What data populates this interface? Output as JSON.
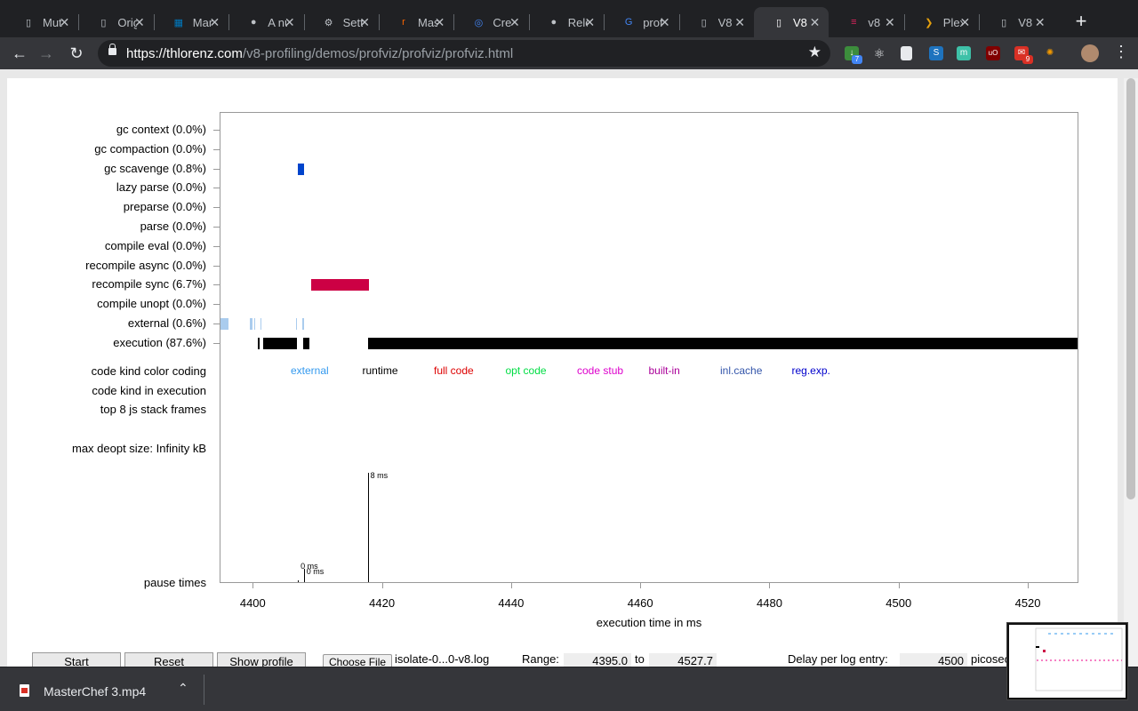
{
  "tabs": [
    {
      "title": "Mut",
      "icon": "page-icon"
    },
    {
      "title": "Orig",
      "icon": "page-icon"
    },
    {
      "title": "Mar",
      "icon": "trello-icon"
    },
    {
      "title": "A nu",
      "icon": "github-icon"
    },
    {
      "title": "Setti",
      "icon": "gear-icon"
    },
    {
      "title": "Mas",
      "icon": "rtve-icon"
    },
    {
      "title": "Cre",
      "icon": "chrome-icon"
    },
    {
      "title": "Rele",
      "icon": "github-icon"
    },
    {
      "title": "prof",
      "icon": "google-icon"
    },
    {
      "title": "V8",
      "icon": "page-icon"
    },
    {
      "title": "V8",
      "icon": "page-icon",
      "active": true
    },
    {
      "title": "v8",
      "icon": "ruler-icon"
    },
    {
      "title": "Plex",
      "icon": "plex-icon"
    },
    {
      "title": "V8",
      "icon": "page-icon"
    }
  ],
  "address": {
    "host": "https://thlorenz.com",
    "path": "/v8-profiling/demos/profviz/profviz/profviz.html"
  },
  "extensions": {
    "badge_1": "7",
    "badge_2": "9"
  },
  "chart_data": {
    "type": "timeline",
    "title": "",
    "xlabel": "execution time in ms",
    "ylabel": "",
    "xlim": [
      4395.0,
      4527.7
    ],
    "x_ticks": [
      "4400",
      "4420",
      "4440",
      "4460",
      "4480",
      "4500",
      "4520"
    ],
    "rows": [
      {
        "label": "gc context (0.0%)",
        "segments": []
      },
      {
        "label": "gc compaction (0.0%)",
        "segments": []
      },
      {
        "label": "gc scavenge (0.8%)",
        "color": "#0044cc",
        "segments": [
          [
            4407.0,
            4408.0
          ]
        ]
      },
      {
        "label": "lazy parse (0.0%)",
        "segments": []
      },
      {
        "label": "preparse (0.0%)",
        "segments": []
      },
      {
        "label": "parse (0.0%)",
        "segments": []
      },
      {
        "label": "compile eval (0.0%)",
        "segments": []
      },
      {
        "label": "recompile async (0.0%)",
        "segments": []
      },
      {
        "label": "recompile sync (6.7%)",
        "color": "#cc0044",
        "segments": [
          [
            4409.0,
            4418.0
          ]
        ]
      },
      {
        "label": "compile unopt (0.0%)",
        "segments": []
      },
      {
        "label": "external (0.6%)",
        "color": "#aaccee",
        "segments": [
          [
            4395.0,
            4396.0
          ],
          [
            4395.7,
            4396.3
          ],
          [
            4399.6,
            4400.0
          ],
          [
            4400.2,
            4400.4
          ],
          [
            4401.2,
            4401.4
          ],
          [
            4406.7,
            4406.9
          ],
          [
            4407.7,
            4407.9
          ]
        ]
      },
      {
        "label": "execution (87.6%)",
        "color": "#000000",
        "segments": [
          [
            4400.8,
            4401.0
          ],
          [
            4401.6,
            4406.8
          ],
          [
            4407.8,
            4408.8
          ],
          [
            4417.9,
            4527.7
          ]
        ]
      }
    ],
    "code_kind_legend": [
      {
        "name": "external",
        "color": "#3399ee"
      },
      {
        "name": "runtime",
        "color": "#000000"
      },
      {
        "name": "full code",
        "color": "#dd0000"
      },
      {
        "name": "opt code",
        "color": "#00dd44"
      },
      {
        "name": "code stub",
        "color": "#dd00cc"
      },
      {
        "name": "built-in",
        "color": "#aa0099"
      },
      {
        "name": "inl.cache",
        "color": "#3355aa"
      },
      {
        "name": "reg.exp.",
        "color": "#0000cc"
      }
    ],
    "other_rows": [
      "code kind color coding",
      "code kind in execution",
      "top 8 js stack frames",
      "max deopt size: Infinity kB",
      "pause times"
    ],
    "pause_times": [
      {
        "x": 4407.0,
        "value": 0,
        "label": "0 ms"
      },
      {
        "x": 4407.9,
        "value": 1,
        "label": "0 ms"
      },
      {
        "x": 4417.8,
        "value": 8,
        "label": "8 ms"
      }
    ]
  },
  "controls": {
    "start": "Start",
    "reset": "Reset",
    "show_profile": "Show profile",
    "choose_file": "Choose File",
    "file_name": "isolate-0...0-v8.log",
    "range_label": "Range:",
    "range_from": "4395.0",
    "to_label": "to",
    "range_to": "4527.7",
    "delay_label": "Delay per log entry:",
    "delay_value": "4500",
    "delay_unit": "picoseconds"
  },
  "download": {
    "name": "MasterChef 3.mp4"
  }
}
